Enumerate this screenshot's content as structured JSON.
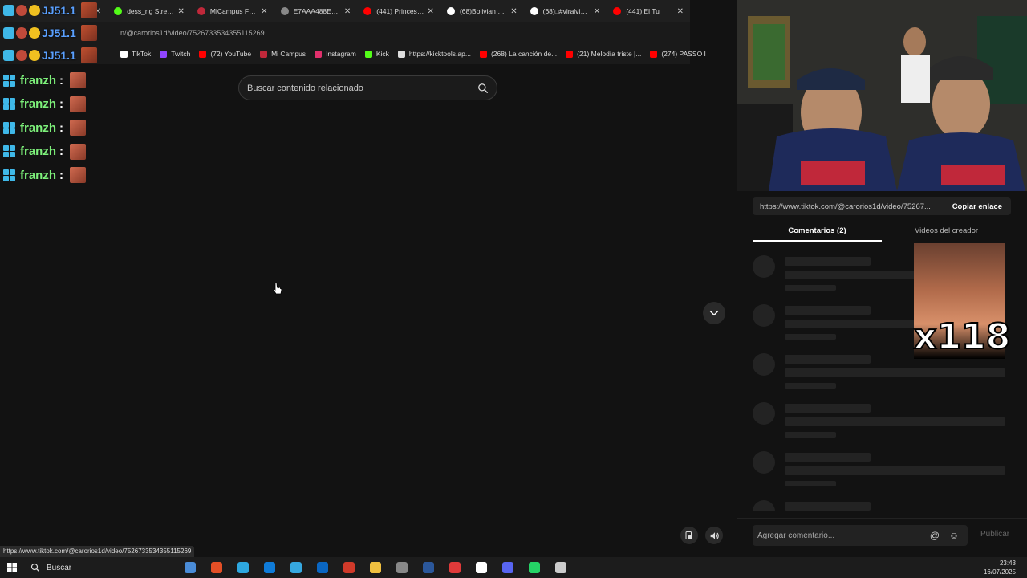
{
  "browser": {
    "tabs": [
      {
        "label": "",
        "color": "#ff4444",
        "first": true
      },
      {
        "label": "dess_ng Stream -",
        "color": "#53fc18"
      },
      {
        "label": "MiCampus FCCTP",
        "color": "#c0283a"
      },
      {
        "label": "E7AAA488E1511F",
        "color": "#888888"
      },
      {
        "label": "(441) Princesa Al",
        "color": "#ff0000"
      },
      {
        "label": "(68)Bolivian Coca",
        "color": "#ffffff"
      },
      {
        "label": "(68)□#viralvideo",
        "color": "#ffffff"
      },
      {
        "label": "(441) El Tu",
        "color": "#ff0000"
      }
    ],
    "address": "n/@carorios1d/video/7526733534355115269",
    "bookmarks": [
      {
        "label": "TikTok",
        "color": "#ffffff"
      },
      {
        "label": "Twitch",
        "color": "#9146ff"
      },
      {
        "label": "(72) YouTube",
        "color": "#ff0000"
      },
      {
        "label": "Mi Campus",
        "color": "#c0283a"
      },
      {
        "label": "Instagram",
        "color": "#e1306c"
      },
      {
        "label": "Kick",
        "color": "#53fc18"
      },
      {
        "label": "https://kicktools.ap...",
        "color": "#dddddd"
      },
      {
        "label": "(268) La canción de...",
        "color": "#ff0000"
      },
      {
        "label": "(21) Melodía triste |...",
        "color": "#ff0000"
      },
      {
        "label": "(274) PASSO I",
        "color": "#ff0000"
      }
    ]
  },
  "overlay": {
    "names": [
      "JJ51.1",
      "JJ51.1",
      "JJ51.1"
    ],
    "chat_user": "franzh",
    "chat_sep": ":",
    "chat_count": 5
  },
  "search": {
    "placeholder": "Buscar contenido relacionado"
  },
  "panel": {
    "link": "https://www.tiktok.com/@carorios1d/video/75267...",
    "copy_label": "Copiar enlace",
    "tab_comments": "Comentarios (2)",
    "tab_creator": "Videos del creador",
    "sticker_text": "x118",
    "comment_placeholder": "Agregar comentario...",
    "publish_label": "Publicar"
  },
  "status_url": "https://www.tiktok.com/@carorios1d/video/7526733534355115269",
  "taskbar": {
    "search_label": "Buscar",
    "time": "23:43",
    "date": "16/07/2025",
    "icons": [
      "#4a8cd8",
      "#e34f26",
      "#2ea8e0",
      "#0f7bd8",
      "#36a8e0",
      "#0a66c2",
      "#d03a2a",
      "#f0c040",
      "#888888",
      "#2b579a",
      "#e03a3a",
      "#ffffff",
      "#5865f2",
      "#25d366",
      "#cccccc"
    ]
  },
  "colors": {
    "accent_green": "#7df07a",
    "accent_blue": "#5aa0ff"
  }
}
